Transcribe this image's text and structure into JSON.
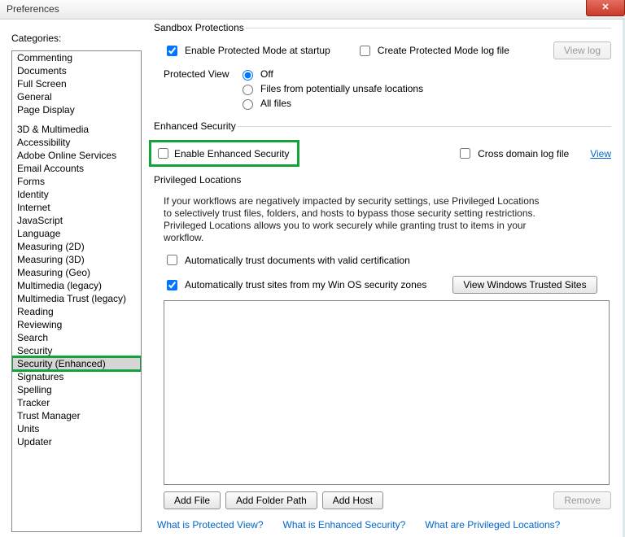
{
  "window": {
    "title": "Preferences"
  },
  "sidebar": {
    "label": "Categories:",
    "items": [
      "Commenting",
      "Documents",
      "Full Screen",
      "General",
      "Page Display",
      "__sep__",
      "3D & Multimedia",
      "Accessibility",
      "Adobe Online Services",
      "Email Accounts",
      "Forms",
      "Identity",
      "Internet",
      "JavaScript",
      "Language",
      "Measuring (2D)",
      "Measuring (3D)",
      "Measuring (Geo)",
      "Multimedia (legacy)",
      "Multimedia Trust (legacy)",
      "Reading",
      "Reviewing",
      "Search",
      "Security",
      "Security (Enhanced)",
      "Signatures",
      "Spelling",
      "Tracker",
      "Trust Manager",
      "Units",
      "Updater"
    ],
    "selected": "Security (Enhanced)"
  },
  "sandbox": {
    "title": "Sandbox Protections",
    "enable_protected": "Enable Protected Mode at startup",
    "create_log": "Create Protected Mode log file",
    "view_log_btn": "View log",
    "protected_view_label": "Protected View",
    "radios": {
      "off": "Off",
      "unsafe": "Files from potentially unsafe locations",
      "all": "All files"
    }
  },
  "enhanced": {
    "title": "Enhanced Security",
    "enable": "Enable Enhanced Security",
    "cross_domain": "Cross domain log file",
    "view_link": "View"
  },
  "privileged": {
    "title": "Privileged Locations",
    "desc": "If your workflows are negatively impacted by security settings, use Privileged Locations to selectively trust files, folders, and hosts to bypass those security setting restrictions. Privileged Locations allows you to work securely while granting trust to items in your workflow.",
    "auto_cert": "Automatically trust documents with valid certification",
    "auto_os": "Automatically trust sites from my Win OS security zones",
    "view_trusted_btn": "View Windows Trusted Sites",
    "add_file_btn": "Add File",
    "add_folder_btn": "Add Folder Path",
    "add_host_btn": "Add Host",
    "remove_btn": "Remove"
  },
  "footer": {
    "l1": "What is Protected View?",
    "l2": "What is Enhanced Security?",
    "l3": "What are Privileged Locations?"
  }
}
